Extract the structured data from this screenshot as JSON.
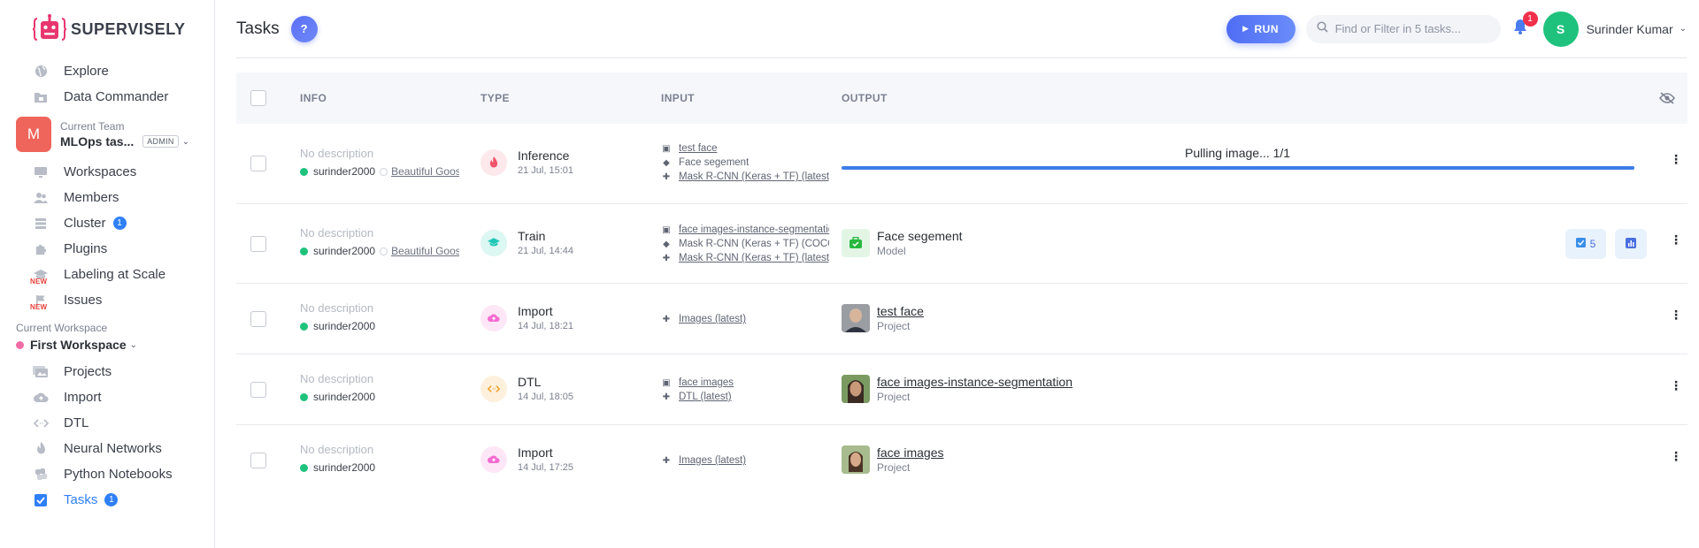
{
  "logo": {
    "text": "SUPERVISELY"
  },
  "sidebar": {
    "top_items": [
      {
        "label": "Explore",
        "icon": "globe-icon"
      },
      {
        "label": "Data Commander",
        "icon": "folder-icon"
      }
    ],
    "team": {
      "label": "Current Team",
      "avatar_letter": "M",
      "name": "MLOps tas...",
      "role": "ADMIN"
    },
    "team_items": [
      {
        "label": "Workspaces",
        "icon": "monitor-icon"
      },
      {
        "label": "Members",
        "icon": "users-icon"
      },
      {
        "label": "Cluster",
        "icon": "server-icon",
        "badge": "1"
      },
      {
        "label": "Plugins",
        "icon": "puzzle-icon"
      },
      {
        "label": "Labeling at Scale",
        "icon": "mortarboard-icon",
        "tag": "NEW"
      },
      {
        "label": "Issues",
        "icon": "flag-icon",
        "tag": "NEW"
      }
    ],
    "workspace": {
      "label": "Current Workspace",
      "name": "First Workspace",
      "dot_color": "#f06ca5"
    },
    "workspace_items": [
      {
        "label": "Projects",
        "icon": "images-icon"
      },
      {
        "label": "Import",
        "icon": "cloud-upload-icon"
      },
      {
        "label": "DTL",
        "icon": "code-icon"
      },
      {
        "label": "Neural Networks",
        "icon": "flame-icon"
      },
      {
        "label": "Python Notebooks",
        "icon": "python-icon"
      },
      {
        "label": "Tasks",
        "icon": "checkbox-icon",
        "badge": "1",
        "active": true
      }
    ]
  },
  "header": {
    "title": "Tasks",
    "help": "?",
    "run_label": "RUN",
    "search_placeholder": "Find or Filter in 5 tasks...",
    "notifications": "1",
    "user_initial": "S",
    "user_name": "Surinder Kumar"
  },
  "table": {
    "columns": [
      "INFO",
      "TYPE",
      "INPUT",
      "OUTPUT"
    ],
    "rows": [
      {
        "description": "No description",
        "user": "surinder2000",
        "session": "Beautiful Goose",
        "type": "Inference",
        "date": "21 Jul, 15:01",
        "type_color": "#f0566b",
        "type_bg": "#fde8ec",
        "type_icon": "flame-icon",
        "inputs": [
          {
            "icon": "images-icon",
            "text": "test face",
            "link": true
          },
          {
            "icon": "mortarboard-icon",
            "text": "Face segement",
            "link": false
          },
          {
            "icon": "puzzle-icon",
            "text": "Mask R-CNN (Keras + TF) (latest)",
            "link": true
          }
        ],
        "progress_label": "Pulling image... 1/1",
        "progress": 1.0
      },
      {
        "description": "No description",
        "user": "surinder2000",
        "session": "Beautiful Goose",
        "type": "Train",
        "date": "21 Jul, 14:44",
        "type_color": "#1fc7b6",
        "type_bg": "#ddf7f3",
        "type_icon": "mortarboard-icon",
        "inputs": [
          {
            "icon": "images-icon",
            "text": "face images-instance-segmentation",
            "link": true
          },
          {
            "icon": "mortarboard-icon",
            "text": "Mask R-CNN (Keras + TF) (COCO)",
            "link": false
          },
          {
            "icon": "puzzle-icon",
            "text": "Mask R-CNN (Keras + TF) (latest)",
            "link": true
          }
        ],
        "output_name": "Face segement",
        "output_type": "Model",
        "output_link": false,
        "checkpoints": "5"
      },
      {
        "description": "No description",
        "user": "surinder2000",
        "type": "Import",
        "date": "14 Jul, 18:21",
        "type_color": "#f36bd0",
        "type_bg": "#fde7f7",
        "type_icon": "cloud-upload-icon",
        "inputs": [
          {
            "icon": "puzzle-icon",
            "text": "Images (latest)",
            "link": true
          }
        ],
        "output_name": "test face",
        "output_type": "Project",
        "output_link": true
      },
      {
        "description": "No description",
        "user": "surinder2000",
        "type": "DTL",
        "date": "14 Jul, 18:05",
        "type_color": "#f2a12b",
        "type_bg": "#fdf0dc",
        "type_icon": "code-icon",
        "inputs": [
          {
            "icon": "images-icon",
            "text": "face images",
            "link": true
          },
          {
            "icon": "puzzle-icon",
            "text": "DTL (latest)",
            "link": true
          }
        ],
        "output_name": "face images-instance-segmentation",
        "output_type": "Project",
        "output_link": true
      },
      {
        "description": "No description",
        "user": "surinder2000",
        "type": "Import",
        "date": "14 Jul, 17:25",
        "type_color": "#f36bd0",
        "type_bg": "#fde7f7",
        "type_icon": "cloud-upload-icon",
        "inputs": [
          {
            "icon": "puzzle-icon",
            "text": "Images (latest)",
            "link": true
          }
        ],
        "output_name": "face images",
        "output_type": "Project",
        "output_link": true
      }
    ]
  }
}
